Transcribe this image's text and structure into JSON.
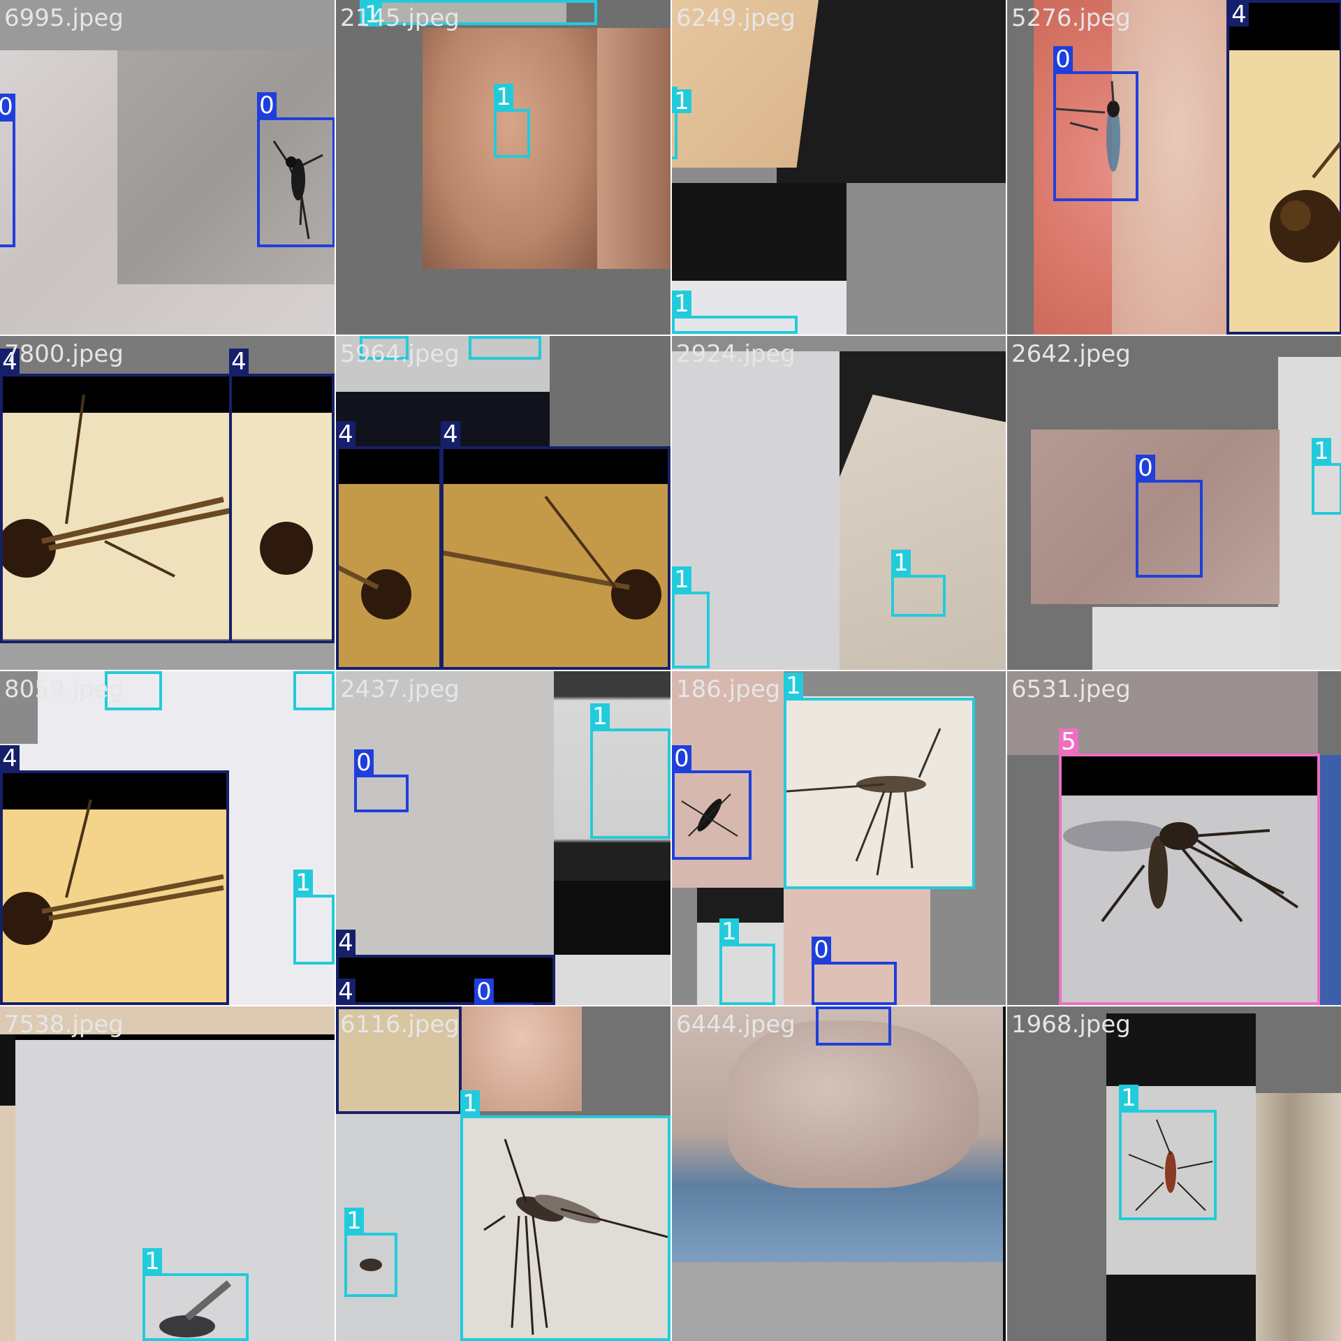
{
  "colors": {
    "class_0": "#1f3fdc",
    "class_1": "#22cbdb",
    "class_4": "#16206a",
    "class_5": "#ee6fc0",
    "filename_text": "#e6e6e6",
    "pad_gray": "#727272"
  },
  "tiles": [
    {
      "filename": "6995.jpeg"
    },
    {
      "filename": "2145.jpeg"
    },
    {
      "filename": "6249.jpeg"
    },
    {
      "filename": "5276.jpeg"
    },
    {
      "filename": "7800.jpeg"
    },
    {
      "filename": "5964.jpeg"
    },
    {
      "filename": "2924.jpeg"
    },
    {
      "filename": "2642.jpeg"
    },
    {
      "filename": "8059.jpeg"
    },
    {
      "filename": "2437.jpeg"
    },
    {
      "filename": "186.jpeg"
    },
    {
      "filename": "6531.jpeg"
    },
    {
      "filename": "7538.jpeg"
    },
    {
      "filename": "6116.jpeg"
    },
    {
      "filename": "6444.jpeg"
    },
    {
      "filename": "1968.jpeg"
    }
  ],
  "labels": {
    "c0": "0",
    "c1": "1",
    "c4": "4",
    "c5": "5"
  }
}
